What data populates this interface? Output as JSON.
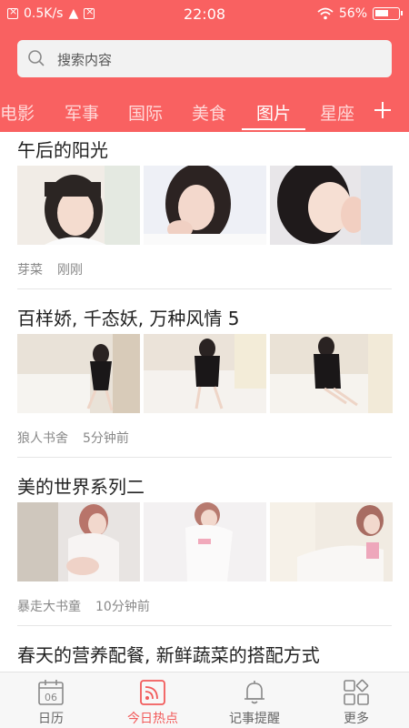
{
  "status_bar": {
    "network_speed": "0.5K/s",
    "time": "22:08",
    "battery": "56%"
  },
  "search": {
    "placeholder": "搜索内容"
  },
  "tabs": [
    {
      "label": "电影"
    },
    {
      "label": "军事"
    },
    {
      "label": "国际"
    },
    {
      "label": "美食"
    },
    {
      "label": "图片",
      "active": true
    },
    {
      "label": "星座"
    }
  ],
  "add_tab_label": "+",
  "articles": [
    {
      "title": "午后的阳光",
      "source": "芽菜",
      "time": "刚刚"
    },
    {
      "title": "百样娇, 千态妖, 万种风情 5",
      "source": "狼人书舍",
      "time": "5分钟前"
    },
    {
      "title": "美的世界系列二",
      "source": "暴走大书童",
      "time": "10分钟前"
    },
    {
      "title": "春天的营养配餐, 新鲜蔬菜的搭配方式"
    }
  ],
  "bottom_nav": [
    {
      "label": "日历",
      "icon": "calendar-icon",
      "date": "06"
    },
    {
      "label": "今日热点",
      "icon": "news-icon",
      "active": true
    },
    {
      "label": "记事提醒",
      "icon": "bell-icon"
    },
    {
      "label": "更多",
      "icon": "grid-icon"
    }
  ],
  "colors": {
    "accent": "#f96161",
    "nav_active": "#f25b5b"
  }
}
